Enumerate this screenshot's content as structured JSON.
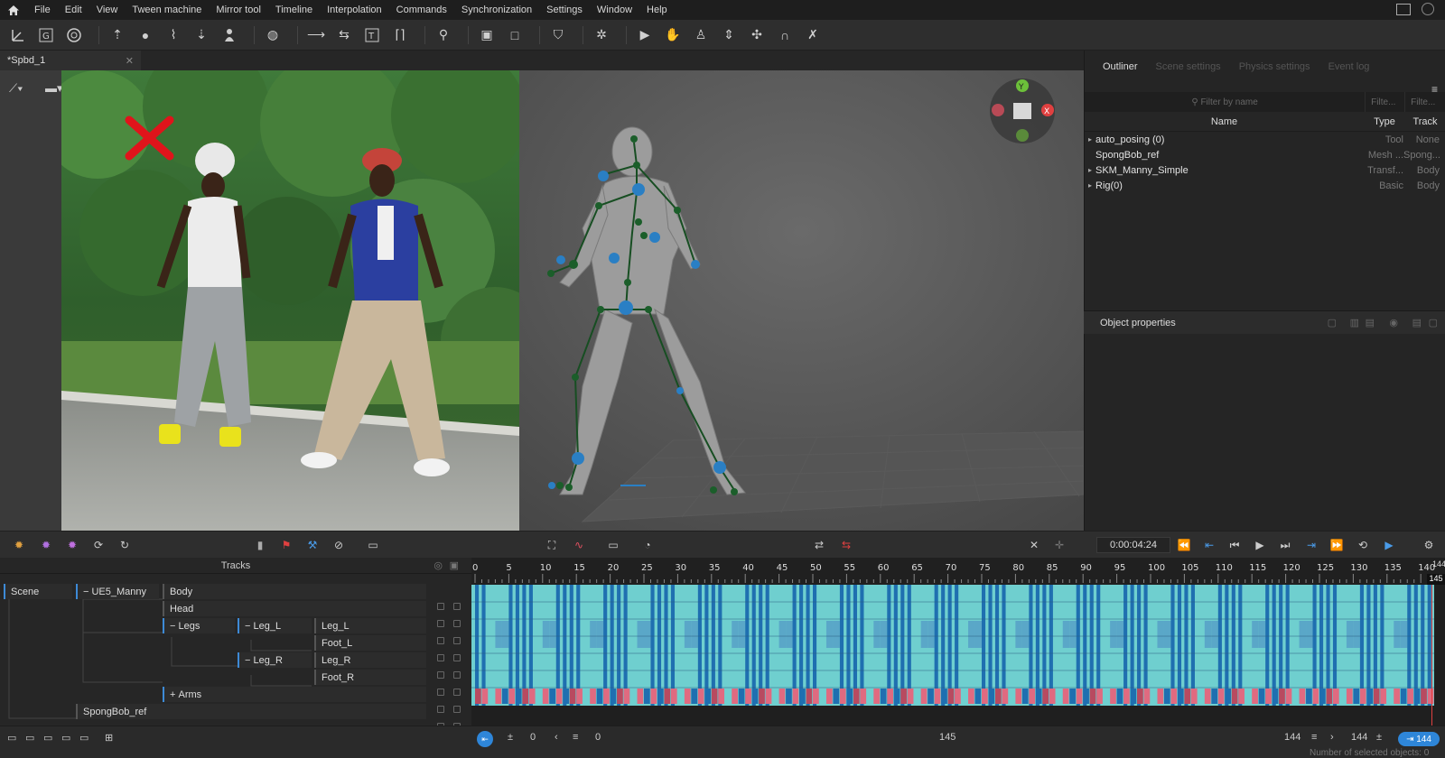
{
  "menu": [
    "File",
    "Edit",
    "View",
    "Tween machine",
    "Mirror tool",
    "Timeline",
    "Interpolation",
    "Commands",
    "Synchronization",
    "Settings",
    "Window",
    "Help"
  ],
  "document": {
    "tab": "*Spbd_1"
  },
  "panel": {
    "tabs": [
      "Outliner",
      "Scene settings",
      "Physics settings",
      "Event log"
    ],
    "filter_placeholder": "Filter by name",
    "filter_small_1": "Filte...",
    "filter_small_2": "Filte...",
    "columns": {
      "name": "Name",
      "type": "Type",
      "track": "Track"
    },
    "rows": [
      {
        "name": "auto_posing (0)",
        "type": "Tool",
        "track": "None",
        "expandable": true
      },
      {
        "name": "SpongBob_ref",
        "type": "Mesh ...",
        "track": "Spong...",
        "expandable": false
      },
      {
        "name": "SKM_Manny_Simple",
        "type": "Transf...",
        "track": "Body",
        "expandable": true
      },
      {
        "name": "Rig(0)",
        "type": "Basic",
        "track": "Body",
        "expandable": true
      }
    ],
    "object_properties": "Object properties"
  },
  "transport": {
    "time": "0:00:04:24"
  },
  "tracks": {
    "header": "Tracks",
    "scene": "Scene",
    "character": "UE5_Manny",
    "body": "Body",
    "head": "Head",
    "legs": "Legs",
    "leg_l_group": "Leg_L",
    "leg_l": "Leg_L",
    "foot_l": "Foot_L",
    "leg_r_group": "Leg_R",
    "leg_r": "Leg_R",
    "foot_r": "Foot_R",
    "arms": "Arms",
    "ref": "SpongBob_ref"
  },
  "ruler": {
    "ticks": [
      "0",
      "5",
      "10",
      "15",
      "20",
      "25",
      "30",
      "35",
      "40",
      "45",
      "50",
      "55",
      "60",
      "65",
      "70",
      "75",
      "80",
      "85",
      "90",
      "95",
      "100",
      "105",
      "110",
      "115",
      "120",
      "125",
      "130",
      "135",
      "140"
    ],
    "end_top": "144",
    "current": "145"
  },
  "footer": {
    "start": "0",
    "current": "0",
    "mid": "145",
    "end1": "144",
    "end2": "144",
    "end3": "144",
    "status": "Number of selected objects: 0"
  },
  "gizmo": {
    "y": "Y",
    "x": "X"
  },
  "colors": {
    "accent": "#3d8ad6",
    "key_light": "#6fcfcf",
    "key_dark": "#1f6fb0",
    "key_red": "#e06a80",
    "joint_blue": "#2a7fc4",
    "joint_green": "#1b5e2a"
  }
}
